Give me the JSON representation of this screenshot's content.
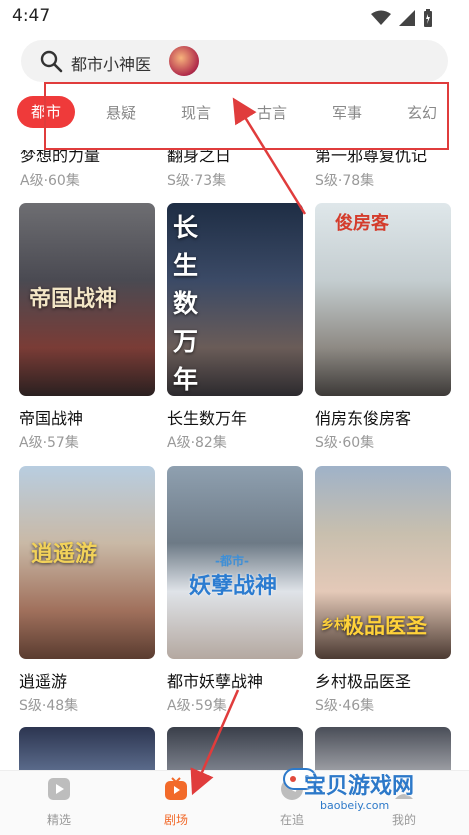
{
  "status": {
    "time": "4:47"
  },
  "search": {
    "query": "都市小神医"
  },
  "tabs": [
    {
      "label": "都市",
      "active": true
    },
    {
      "label": "悬疑"
    },
    {
      "label": "现言"
    },
    {
      "label": "古言"
    },
    {
      "label": "军事"
    },
    {
      "label": "玄幻"
    }
  ],
  "partial_row": [
    {
      "title": "梦想的力量",
      "meta": "A级·60集"
    },
    {
      "title": "翻身之日",
      "meta": "S级·73集"
    },
    {
      "title": "第一邪尊复仇记",
      "meta": "S级·78集"
    }
  ],
  "row1": [
    {
      "title": "帝国战神",
      "meta": "A级·57集",
      "poster_text": "帝国战神"
    },
    {
      "title": "长生数万年",
      "meta": "A级·82集",
      "poster_text": "长生数万年"
    },
    {
      "title": "俏房东俊房客",
      "meta": "S级·60集",
      "poster_text": "俊房客"
    }
  ],
  "row2": [
    {
      "title": "逍遥游",
      "meta": "S级·48集",
      "poster_text": "逍遥游"
    },
    {
      "title": "都市妖孽战神",
      "meta": "A级·59集",
      "poster_text": "妖孽战神",
      "poster_sub": "-都市-"
    },
    {
      "title": "乡村极品医圣",
      "meta": "S级·46集",
      "poster_text": "极品医圣",
      "poster_sub": "乡村"
    }
  ],
  "nav": [
    {
      "label": "精选",
      "icon": "play-icon"
    },
    {
      "label": "剧场",
      "icon": "tv-icon",
      "active": true
    },
    {
      "label": "在追",
      "icon": "clock-icon"
    },
    {
      "label": "我的",
      "icon": "user-icon"
    }
  ],
  "watermark": {
    "text": "宝贝游戏网",
    "domain": "baobeiy.com"
  },
  "colors": {
    "accent": "#ef3a3a",
    "annotation": "#e03c3c",
    "nav_active": "#f26a2a"
  }
}
